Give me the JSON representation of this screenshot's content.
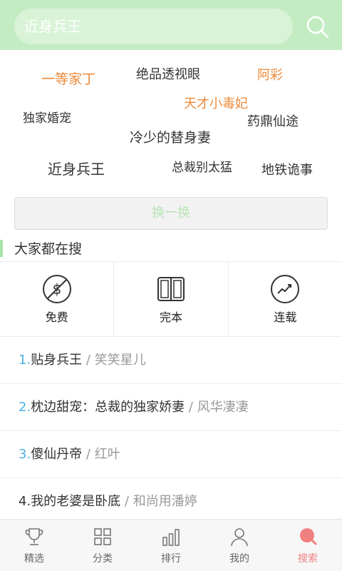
{
  "colors": {
    "header_bg": "#c3ecc2",
    "accent_orange": "#ec8a3a",
    "rank_blue": "#4fb0e2",
    "tab_active": "#f08080",
    "swap_text": "#b9e5b7"
  },
  "search": {
    "value": "近身兵王",
    "button_icon": "search-icon"
  },
  "tags": [
    {
      "text": "一等家丁",
      "color": "#ec8a3a"
    },
    {
      "text": "绝品透视眼",
      "color": "#333333"
    },
    {
      "text": "阿彩",
      "color": "#ec8a3a"
    },
    {
      "text": "天才小毒妃",
      "color": "#ec8a3a"
    },
    {
      "text": "独家婚宠",
      "color": "#333333"
    },
    {
      "text": "药鼎仙途",
      "color": "#333333"
    },
    {
      "text": "冷少的替身妻",
      "color": "#333333"
    },
    {
      "text": "近身兵王",
      "color": "#333333"
    },
    {
      "text": "总裁别太猛",
      "color": "#333333"
    },
    {
      "text": "地铁诡事",
      "color": "#333333"
    }
  ],
  "swap_label": "换一换",
  "section_title": "大家都在搜",
  "categories": [
    {
      "label": "免费",
      "icon": "dollar-icon"
    },
    {
      "label": "完本",
      "icon": "book-icon"
    },
    {
      "label": "连载",
      "icon": "trend-icon"
    }
  ],
  "hot_list": [
    {
      "rank": "1.",
      "title": "贴身兵王",
      "sep": " / ",
      "author": "笑笑星儿"
    },
    {
      "rank": "2.",
      "title": "枕边甜宠：总裁的独家娇妻",
      "sep": " / ",
      "author": "风华凄凄"
    },
    {
      "rank": "3.",
      "title": "傻仙丹帝",
      "sep": " / ",
      "author": "红叶"
    },
    {
      "rank": "4.",
      "title": "我的老婆是卧底",
      "sep": " / ",
      "author": "和尚用潘婷"
    }
  ],
  "tabs": [
    {
      "label": "精选",
      "icon": "trophy-icon",
      "active": false
    },
    {
      "label": "分类",
      "icon": "grid-icon",
      "active": false
    },
    {
      "label": "排行",
      "icon": "bar-chart-icon",
      "active": false
    },
    {
      "label": "我的",
      "icon": "user-icon",
      "active": false
    },
    {
      "label": "搜索",
      "icon": "search-icon",
      "active": true
    }
  ]
}
